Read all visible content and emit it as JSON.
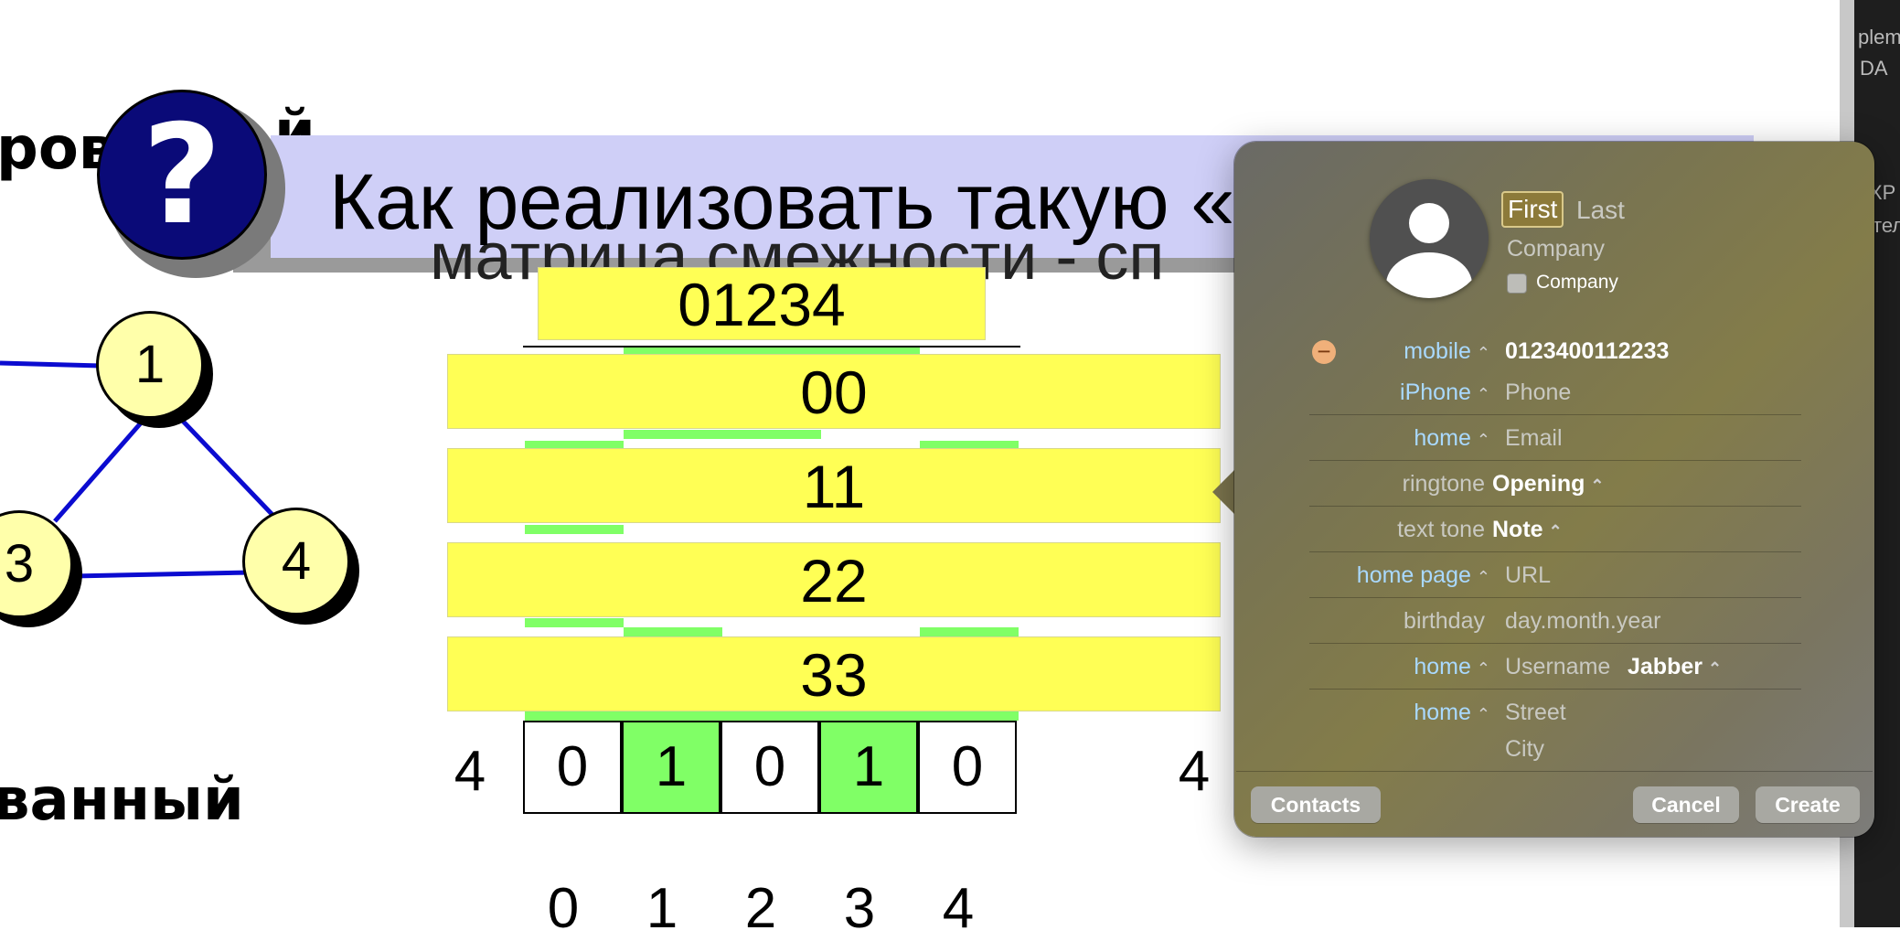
{
  "slide": {
    "heading_fragment_top": "рова",
    "heading_fragment_top_tail": "й",
    "heading_fragment_bottom": "ванный",
    "banner_text": "Как реализовать такую «",
    "subtitle_fragment": "матрица смежности - сп",
    "question_mark": "?",
    "header_box": "01234",
    "row_boxes": [
      "00",
      "11",
      "22",
      "33"
    ],
    "row4": {
      "label_left": "4",
      "cells": [
        "0",
        "1",
        "0",
        "1",
        "0"
      ],
      "label_right": "4"
    },
    "column_labels": [
      "0",
      "1",
      "2",
      "3",
      "4"
    ],
    "graph_nodes": [
      "1",
      "3",
      "4"
    ]
  },
  "contact_card": {
    "first_placeholder": "First",
    "last_placeholder": "Last",
    "company_placeholder": "Company",
    "company_checkbox_label": "Company",
    "rows": {
      "mobile_label": "mobile",
      "mobile_value": "0123400112233",
      "iphone_label": "iPhone",
      "iphone_placeholder": "Phone",
      "email_label": "home",
      "email_placeholder": "Email",
      "ringtone_label": "ringtone",
      "ringtone_value": "Opening",
      "texttone_label": "text tone",
      "texttone_value": "Note",
      "homepage_label": "home page",
      "homepage_placeholder": "URL",
      "birthday_label": "birthday",
      "birthday_placeholder": "day.month.year",
      "im_label": "home",
      "im_placeholder": "Username",
      "im_service": "Jabber",
      "address_label": "home",
      "street_placeholder": "Street",
      "city_placeholder": "City"
    },
    "buttons": {
      "contacts": "Contacts",
      "cancel": "Cancel",
      "create": "Create"
    }
  },
  "right_strip": {
    "fragments": [
      "plem",
      "DA",
      "XP",
      "тел"
    ]
  }
}
